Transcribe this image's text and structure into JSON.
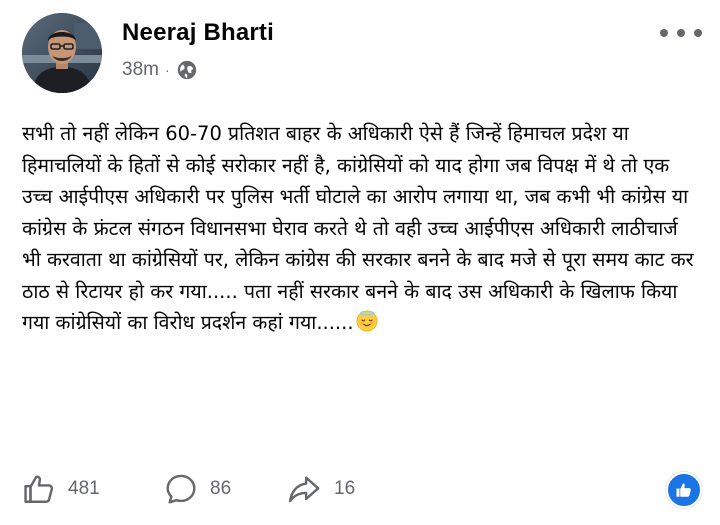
{
  "post": {
    "author": {
      "name": "Neeraj Bharti",
      "avatar_icon": "profile-photo"
    },
    "meta": {
      "time": "38m",
      "separator": "·",
      "audience_icon": "globe-icon"
    },
    "more_icon": "more-horizontal-icon",
    "text": "सभी तो नहीं लेकिन 60-70 प्रतिशत बाहर के अधिकारी ऐसे हैं जिन्हें हिमाचल प्रदेश या हिमाचलियों के हितों से कोई सरोकार नहीं है, कांग्रेसियों को याद होगा जब विपक्ष में थे तो एक उच्च आईपीएस अधिकारी पर पुलिस भर्ती घोटाले का आरोप लगाया था, जब कभी भी कांग्रेस या कांग्रेस के फ्रंटल संगठन विधानसभा घेराव करते थे तो वही उच्च आईपीएस अधिकारी लाठीचार्ज भी करवाता था कांग्रेसियों पर, लेकिन कांग्रेस की सरकार बनने के बाद मजे से पूरा समय काट कर ठाठ से रिटायर हो कर गया..... पता नहीं सरकार बनने के बाद उस अधिकारी के खिलाफ किया गया कांग्रेसियों का विरोध प्रदर्शन कहां गया......",
    "text_emoji": "relieved-face-emoji"
  },
  "actions": {
    "like": {
      "icon": "thumbs-up-icon",
      "count": "481"
    },
    "comment": {
      "icon": "comment-bubble-icon",
      "count": "86"
    },
    "share": {
      "icon": "share-arrow-icon",
      "count": "16"
    },
    "reaction_badge_icon": "like-reaction-icon"
  },
  "colors": {
    "text": "#050505",
    "secondary": "#65676b",
    "reaction_blue": "#1b74e4"
  }
}
